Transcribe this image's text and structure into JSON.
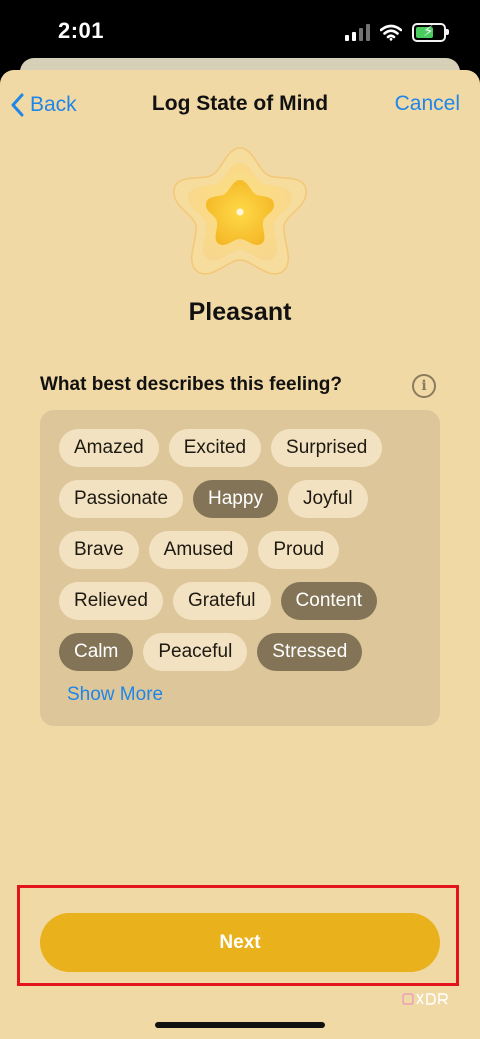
{
  "status_bar": {
    "time": "2:01"
  },
  "nav": {
    "back_label": "Back",
    "title": "Log State of Mind",
    "cancel_label": "Cancel"
  },
  "mood": {
    "label": "Pleasant"
  },
  "question": {
    "text": "What best describes this feeling?"
  },
  "tags": [
    {
      "label": "Amazed",
      "selected": false
    },
    {
      "label": "Excited",
      "selected": false
    },
    {
      "label": "Surprised",
      "selected": false
    },
    {
      "label": "Passionate",
      "selected": false
    },
    {
      "label": "Happy",
      "selected": true
    },
    {
      "label": "Joyful",
      "selected": false
    },
    {
      "label": "Brave",
      "selected": false
    },
    {
      "label": "Amused",
      "selected": false
    },
    {
      "label": "Proud",
      "selected": false
    },
    {
      "label": "Relieved",
      "selected": false
    },
    {
      "label": "Grateful",
      "selected": false
    },
    {
      "label": "Content",
      "selected": true
    },
    {
      "label": "Calm",
      "selected": true
    },
    {
      "label": "Peaceful",
      "selected": false
    },
    {
      "label": "Stressed",
      "selected": true
    }
  ],
  "show_more_label": "Show More",
  "next_label": "Next",
  "colors": {
    "sheet_background": "#f1d9a5",
    "accent_blue": "#1f86e8",
    "next_button": "#e9b11c",
    "tag_selected": "#847457",
    "tag_default": "#f2e2c1",
    "highlight": "#e3141c"
  },
  "icons": [
    "chevron-left-icon",
    "info-icon",
    "signal-icon",
    "wifi-icon",
    "battery-charging-icon",
    "flower-mood-icon"
  ]
}
